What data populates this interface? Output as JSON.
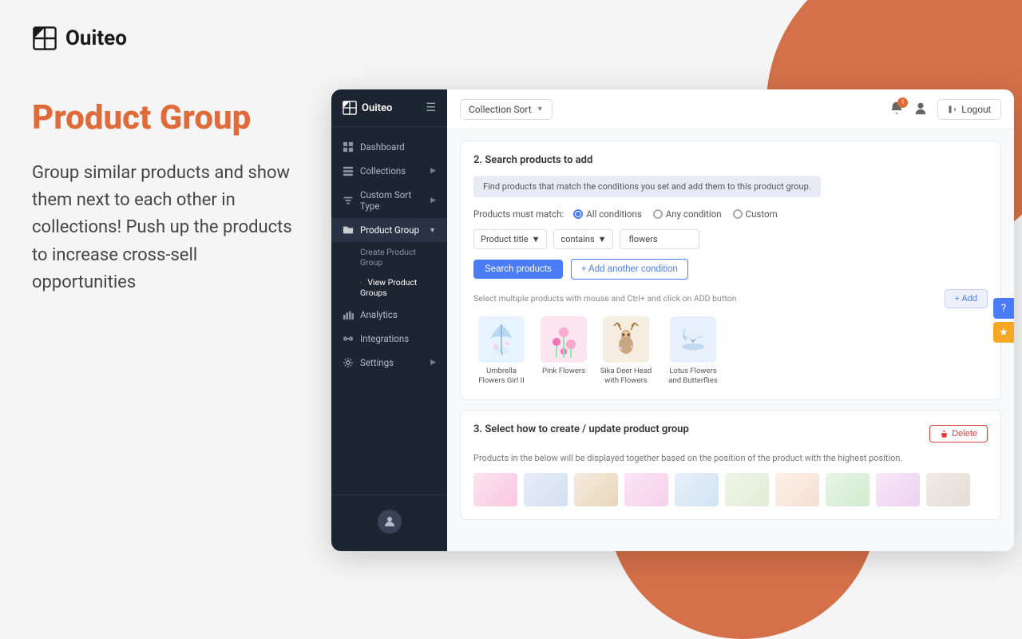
{
  "brand": {
    "name": "Ouiteo",
    "logo_alt": "Ouiteo Logo"
  },
  "left_panel": {
    "title": "Product Group",
    "description": "Group similar products and show them next to each other in collections! Push up the products to increase cross-sell opportunities"
  },
  "topbar": {
    "dropdown_label": "Collection Sort",
    "logout_label": "Logout",
    "notification_count": "1"
  },
  "sidebar": {
    "logo": "Ouiteo",
    "items": [
      {
        "id": "dashboard",
        "label": "Dashboard",
        "icon": "grid"
      },
      {
        "id": "collections",
        "label": "Collections",
        "icon": "layers",
        "has_arrow": true
      },
      {
        "id": "custom-sort-type",
        "label": "Custom Sort Type",
        "icon": "sliders",
        "has_arrow": true
      },
      {
        "id": "product-group",
        "label": "Product Group",
        "icon": "tag",
        "active": true,
        "has_arrow": true
      },
      {
        "id": "analytics",
        "label": "Analytics",
        "icon": "bar-chart"
      },
      {
        "id": "integrations",
        "label": "Integrations",
        "icon": "link"
      },
      {
        "id": "settings",
        "label": "Settings",
        "icon": "settings",
        "has_arrow": true
      }
    ],
    "sub_items": [
      {
        "label": "Create Product Group",
        "active": false
      },
      {
        "label": "View Product Groups",
        "active": false
      }
    ]
  },
  "section2": {
    "title": "2. Search products to add",
    "info_banner": "Find products that match the conditions you set and add them to this product group.",
    "products_must_match_label": "Products must match:",
    "match_options": [
      "All conditions",
      "Any condition",
      "Custom"
    ],
    "selected_match": "All conditions",
    "filter": {
      "field_label": "Product title",
      "operator_label": "contains",
      "value": "flowers"
    },
    "search_btn": "Search products",
    "add_condition_btn": "+ Add another condition",
    "select_hint": "Select multiple products with mouse and Ctrl+ and click on ADD button",
    "add_btn": "+ Add",
    "products": [
      {
        "label": "Umbrella Flowers Girl II",
        "color": "umbrella"
      },
      {
        "label": "Pink Flowers",
        "color": "pink-flowers"
      },
      {
        "label": "Sika Deer Head with Flowers",
        "color": "deer"
      },
      {
        "label": "Lotus Flowers and Butterflies",
        "color": "lotus"
      }
    ]
  },
  "section3": {
    "title": "3. Select how to create / update product group",
    "description": "Products in the below will be displayed together based on the position of the product with the highest position.",
    "delete_btn": "Delete",
    "products_count": 10
  },
  "helper_buttons": {
    "question": "?",
    "star": "★"
  }
}
